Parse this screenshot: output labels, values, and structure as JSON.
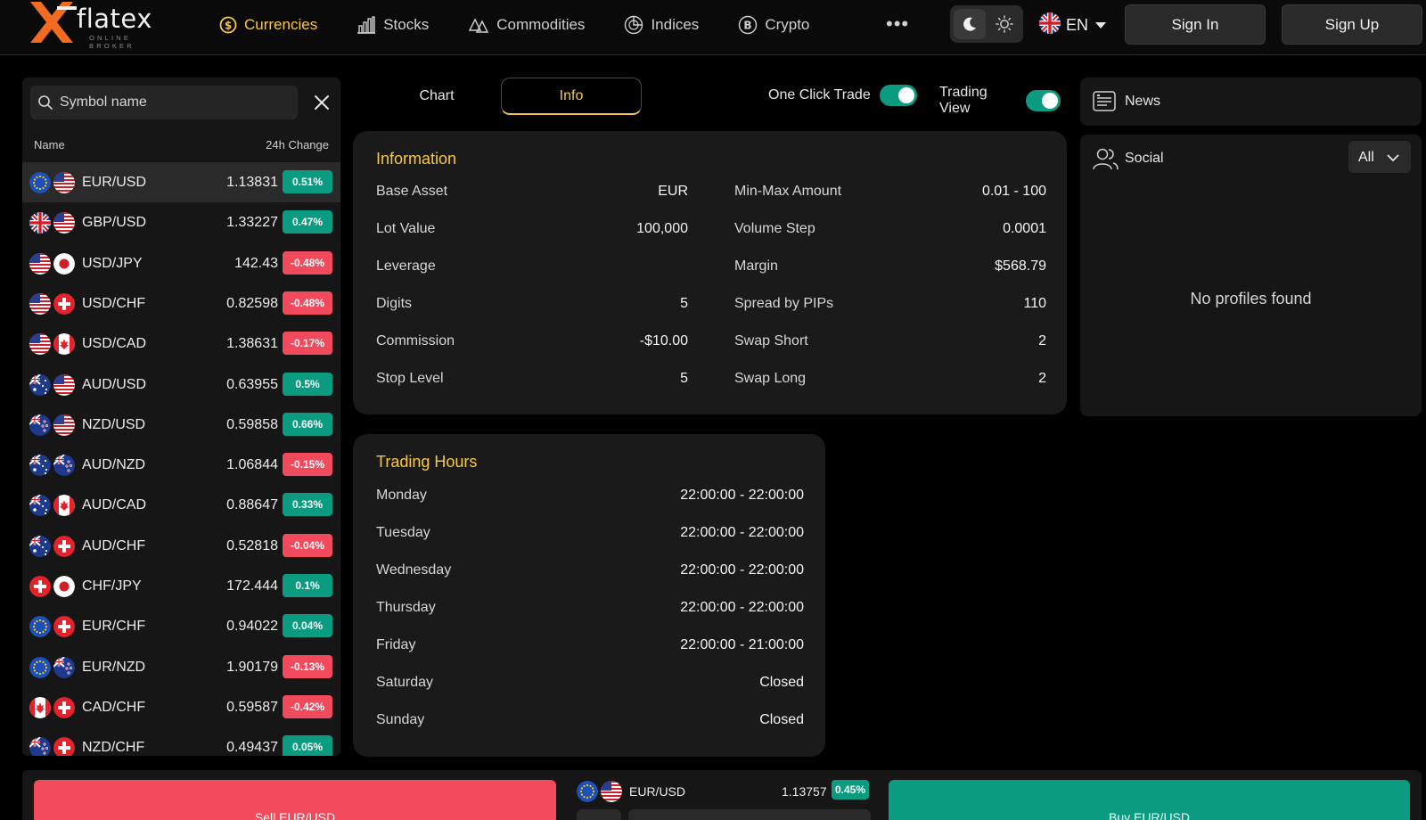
{
  "brand": {
    "name": "flatex",
    "tagline": "ONLINE BROKER",
    "accent": "#f7c744",
    "logo_orange": "#f26b21"
  },
  "nav": {
    "items": [
      {
        "label": "Currencies",
        "icon": "dollar-coin-icon",
        "active": true
      },
      {
        "label": "Stocks",
        "icon": "bar-chart-icon"
      },
      {
        "label": "Commodities",
        "icon": "commodities-icon"
      },
      {
        "label": "Indices",
        "icon": "indices-icon"
      },
      {
        "label": "Crypto",
        "icon": "bitcoin-icon"
      }
    ],
    "more_label": "•••"
  },
  "header": {
    "theme_icons": [
      "moon-icon",
      "sun-icon"
    ],
    "language": "EN",
    "signin_label": "Sign In",
    "signup_label": "Sign Up"
  },
  "symbols": {
    "search_placeholder": "Symbol name",
    "col_name": "Name",
    "col_change": "24h Change",
    "colors": {
      "up": "#0a9b80",
      "down": "#f04a5c"
    },
    "rows": [
      {
        "symbol": "EUR/USD",
        "price": "1.13831",
        "change": "0.51%",
        "dir": "up",
        "f1": "eu",
        "f2": "us",
        "selected": true
      },
      {
        "symbol": "GBP/USD",
        "price": "1.33227",
        "change": "0.47%",
        "dir": "up",
        "f1": "gb",
        "f2": "us"
      },
      {
        "symbol": "USD/JPY",
        "price": "142.43",
        "change": "-0.48%",
        "dir": "down",
        "f1": "us",
        "f2": "jp"
      },
      {
        "symbol": "USD/CHF",
        "price": "0.82598",
        "change": "-0.48%",
        "dir": "down",
        "f1": "us",
        "f2": "ch"
      },
      {
        "symbol": "USD/CAD",
        "price": "1.38631",
        "change": "-0.17%",
        "dir": "down",
        "f1": "us",
        "f2": "ca"
      },
      {
        "symbol": "AUD/USD",
        "price": "0.63955",
        "change": "0.5%",
        "dir": "up",
        "f1": "au",
        "f2": "us"
      },
      {
        "symbol": "NZD/USD",
        "price": "0.59858",
        "change": "0.66%",
        "dir": "up",
        "f1": "nz",
        "f2": "us"
      },
      {
        "symbol": "AUD/NZD",
        "price": "1.06844",
        "change": "-0.15%",
        "dir": "down",
        "f1": "au",
        "f2": "nz"
      },
      {
        "symbol": "AUD/CAD",
        "price": "0.88647",
        "change": "0.33%",
        "dir": "up",
        "f1": "au",
        "f2": "ca"
      },
      {
        "symbol": "AUD/CHF",
        "price": "0.52818",
        "change": "-0.04%",
        "dir": "down",
        "f1": "au",
        "f2": "ch"
      },
      {
        "symbol": "CHF/JPY",
        "price": "172.444",
        "change": "0.1%",
        "dir": "up",
        "f1": "ch",
        "f2": "jp"
      },
      {
        "symbol": "EUR/CHF",
        "price": "0.94022",
        "change": "0.04%",
        "dir": "up",
        "f1": "eu",
        "f2": "ch"
      },
      {
        "symbol": "EUR/NZD",
        "price": "1.90179",
        "change": "-0.13%",
        "dir": "down",
        "f1": "eu",
        "f2": "nz"
      },
      {
        "symbol": "CAD/CHF",
        "price": "0.59587",
        "change": "-0.42%",
        "dir": "down",
        "f1": "ca",
        "f2": "ch"
      },
      {
        "symbol": "NZD/CHF",
        "price": "0.49437",
        "change": "0.05%",
        "dir": "up",
        "f1": "nz",
        "f2": "ch"
      }
    ]
  },
  "tabs": {
    "chart_label": "Chart",
    "info_label": "Info",
    "one_click_label": "One Click Trade",
    "one_click_on": true,
    "trading_view_label": "Trading View",
    "trading_view_on": true
  },
  "information": {
    "title": "Information",
    "left": [
      {
        "label": "Base Asset",
        "value": "EUR"
      },
      {
        "label": "Lot Value",
        "value": "100,000"
      },
      {
        "label": "Leverage",
        "value": ""
      },
      {
        "label": "Digits",
        "value": "5"
      },
      {
        "label": "Commission",
        "value": "-$10.00"
      },
      {
        "label": "Stop Level",
        "value": "5"
      }
    ],
    "right": [
      {
        "label": "Min-Max Amount",
        "value": "0.01 - 100"
      },
      {
        "label": "Volume Step",
        "value": "0.0001"
      },
      {
        "label": "Margin",
        "value": "$568.79"
      },
      {
        "label": "Spread by PIPs",
        "value": "110"
      },
      {
        "label": "Swap Short",
        "value": "2"
      },
      {
        "label": "Swap Long",
        "value": "2"
      }
    ]
  },
  "trading_hours": {
    "title": "Trading Hours",
    "days": [
      {
        "day": "Monday",
        "hours": "22:00:00 - 22:00:00"
      },
      {
        "day": "Tuesday",
        "hours": "22:00:00 - 22:00:00"
      },
      {
        "day": "Wednesday",
        "hours": "22:00:00 - 22:00:00"
      },
      {
        "day": "Thursday",
        "hours": "22:00:00 - 22:00:00"
      },
      {
        "day": "Friday",
        "hours": "22:00:00 - 21:00:00"
      },
      {
        "day": "Saturday",
        "hours": "Closed"
      },
      {
        "day": "Sunday",
        "hours": "Closed"
      }
    ]
  },
  "news": {
    "title": "News"
  },
  "social": {
    "title": "Social",
    "filter": "All",
    "empty": "No profiles found"
  },
  "trade": {
    "sell_label": "Sell EUR/USD",
    "buy_label": "Buy EUR/USD",
    "symbol": "EUR/USD",
    "price": "1.13757",
    "change": "0.45%"
  }
}
